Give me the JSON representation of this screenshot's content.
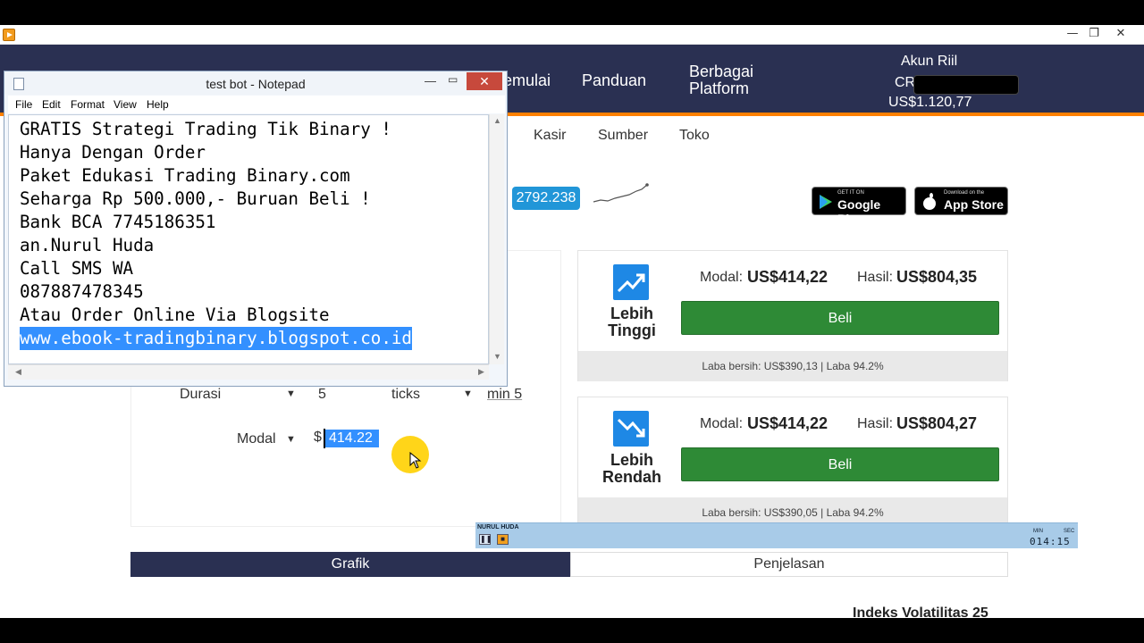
{
  "app": {
    "minimize": "—",
    "restore": "❐",
    "close": "✕"
  },
  "header": {
    "nav": [
      "Memulai",
      "Panduan"
    ],
    "platform_line1": "Berbagai",
    "platform_line2": "Platform",
    "account_type": "Akun Riil",
    "account_prefix": "CR",
    "balance": "US$1.120,77"
  },
  "subnav": [
    "Kasir",
    "Sumber",
    "Toko"
  ],
  "tick_value": "2792.238",
  "stores": {
    "google_small": "GET IT ON",
    "google_big": "Google Play",
    "apple_small": "Download on the",
    "apple_big": "App Store"
  },
  "trade_form": {
    "duration_label": "Durasi",
    "duration_value": "5",
    "duration_unit": "ticks",
    "duration_min": "min 5",
    "stake_label": "Modal",
    "currency_symbol": "$",
    "stake_value": "414.22"
  },
  "contracts": [
    {
      "name_line1": "Lebih",
      "name_line2": "Tinggi",
      "stake_label": "Modal:",
      "stake": "US$414,22",
      "payout_label": "Hasil:",
      "payout": "US$804,35",
      "buy_label": "Beli",
      "profit_text": "Laba bersih: US$390,13 | Laba 94.2%"
    },
    {
      "name_line1": "Lebih",
      "name_line2": "Rendah",
      "stake_label": "Modal:",
      "stake": "US$414,22",
      "payout_label": "Hasil:",
      "payout": "US$804,27",
      "buy_label": "Beli",
      "profit_text": "Laba bersih: US$390,05 | Laba 94.2%"
    }
  ],
  "tabs": [
    "Grafik",
    "Penjelasan"
  ],
  "index_title": "Indeks Volatilitas 25",
  "recorder": {
    "name": "NURUL HUDA",
    "min_label": "MIN",
    "sec_label": "SEC",
    "time": "014:15"
  },
  "notepad": {
    "title": "test bot - Notepad",
    "menu": [
      "File",
      "Edit",
      "Format",
      "View",
      "Help"
    ],
    "lines": [
      "GRATIS Strategi Trading Tik Binary !",
      "Hanya Dengan Order",
      "Paket Edukasi Trading Binary.com",
      "Seharga Rp 500.000,- Buruan Beli !",
      "Bank BCA 7745186351",
      "an.Nurul Huda",
      "Call SMS WA",
      "087887478345",
      "Atau Order Online Via Blogsite",
      "www.ebook-tradingbinary.blogspot.co.id"
    ]
  },
  "colors": {
    "header_bg": "#2a3052",
    "accent_orange": "#ff8000",
    "buy_green": "#2e8a36",
    "contract_blue": "#1e88e5",
    "selection_blue": "#3390ff"
  }
}
